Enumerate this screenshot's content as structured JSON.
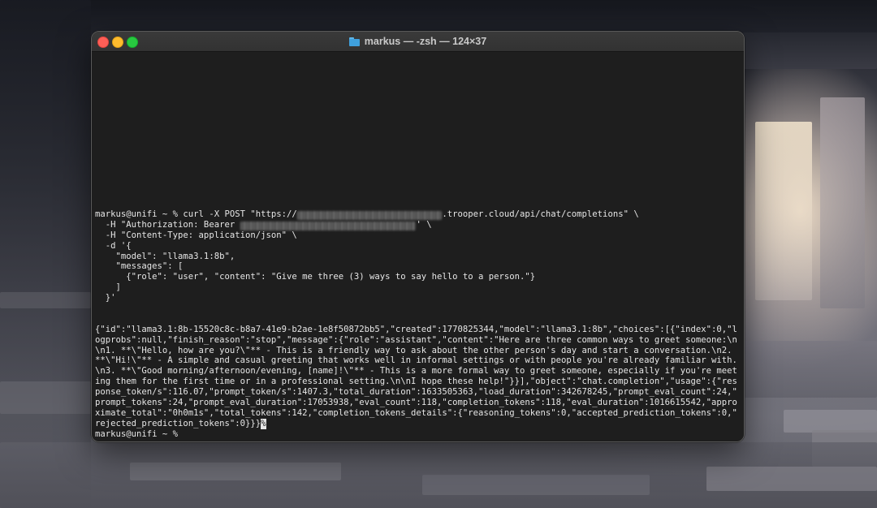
{
  "window": {
    "title": "markus — -zsh — 124×37"
  },
  "terminal": {
    "command_lines": [
      {
        "pre": "markus@unifi ~ % curl -X POST \"https://",
        "redacted": "xxxxxxxxxxxxxxxxxxxxxxxxxxxx",
        "post": ".trooper.cloud/api/chat/completions\" \\"
      },
      {
        "pre": "  -H \"Authorization: Bearer ",
        "redacted": "xxxxxxxxxxxxxxxxxxxxxxxxxxxxxxxxxx",
        "post": "' \\"
      },
      {
        "pre": "  -H \"Content-Type: application/json\" \\",
        "redacted": "",
        "post": ""
      },
      {
        "pre": "  -d '{",
        "redacted": "",
        "post": ""
      },
      {
        "pre": "    \"model\": \"llama3.1:8b\",",
        "redacted": "",
        "post": ""
      },
      {
        "pre": "    \"messages\": [",
        "redacted": "",
        "post": ""
      },
      {
        "pre": "      {\"role\": \"user\", \"content\": \"Give me three (3) ways to say hello to a person.\"}",
        "redacted": "",
        "post": ""
      },
      {
        "pre": "    ]",
        "redacted": "",
        "post": ""
      },
      {
        "pre": "  }'",
        "redacted": "",
        "post": ""
      }
    ],
    "output_lines": [
      "{\"id\":\"llama3.1:8b-15520c8c-b8a7-41e9-b2ae-1e8f50872bb5\",\"created\":1770825344,\"model\":\"llama3.1:8b\",\"choices\":[{\"index\":0,\"l",
      "ogprobs\":null,\"finish_reason\":\"stop\",\"message\":{\"role\":\"assistant\",\"content\":\"Here are three common ways to greet someone:\\n",
      "\\n1. **\\\"Hello, how are you?\\\"** - This is a friendly way to ask about the other person's day and start a conversation.\\n2.",
      "**\\\"Hi!\\\"** - A simple and casual greeting that works well in informal settings or with people you're already familiar with.",
      "\\n3. **\\\"Good morning/afternoon/evening, [name]!\\\"** - This is a more formal way to greet someone, especially if you're meet",
      "ing them for the first time or in a professional setting.\\n\\nI hope these help!\"}}],\"object\":\"chat.completion\",\"usage\":{\"res",
      "ponse_token/s\":116.07,\"prompt_token/s\":1407.3,\"total_duration\":1633505363,\"load_duration\":342678245,\"prompt_eval_count\":24,\"",
      "prompt_tokens\":24,\"prompt_eval_duration\":17053938,\"eval_count\":118,\"completion_tokens\":118,\"eval_duration\":1016615542,\"appro",
      "ximate_total\":\"0h0m1s\",\"total_tokens\":142,\"completion_tokens_details\":{\"reasoning_tokens\":0,\"accepted_prediction_tokens\":0,\""
    ],
    "last_output_line": "rejected_prediction_tokens\":0}}}",
    "cursor_char": "%",
    "final_prompt": "markus@unifi ~ %"
  }
}
